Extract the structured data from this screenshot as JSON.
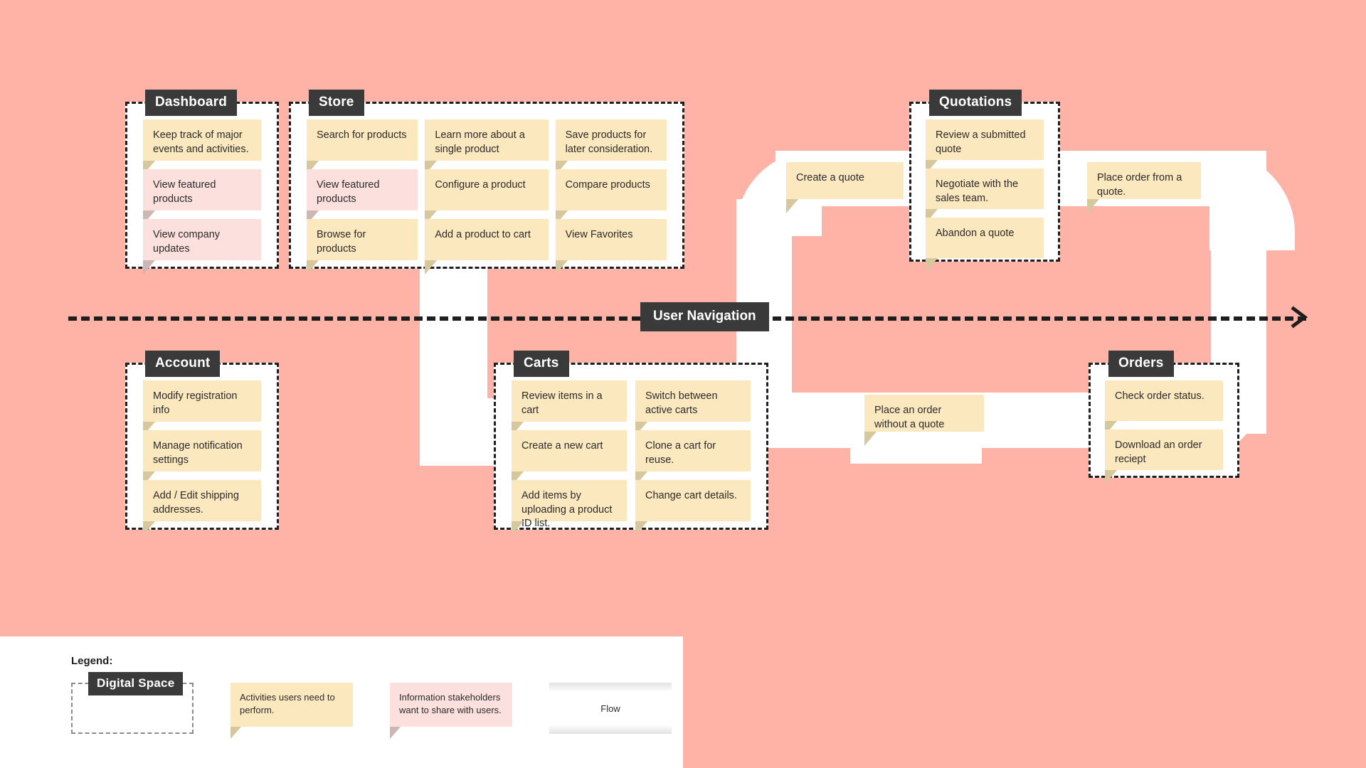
{
  "canvas": {
    "background": "#FFB3A7",
    "flow_color": "#FFFFFF"
  },
  "axis": {
    "label": "User Navigation",
    "arrow_icon": "arrow-right-icon"
  },
  "spaces": [
    {
      "id": "dashboard",
      "title": "Dashboard",
      "columns": [
        {
          "notes": [
            {
              "text": "Keep track of major events and activities.",
              "kind": "activity"
            },
            {
              "text": "View featured products",
              "kind": "info"
            },
            {
              "text": "View company updates",
              "kind": "info"
            }
          ]
        }
      ]
    },
    {
      "id": "store",
      "title": "Store",
      "columns": [
        {
          "notes": [
            {
              "text": "Search for products",
              "kind": "activity"
            },
            {
              "text": "View featured products",
              "kind": "info"
            },
            {
              "text": "Browse for products",
              "kind": "activity"
            }
          ]
        },
        {
          "notes": [
            {
              "text": "Learn more about a single product",
              "kind": "activity"
            },
            {
              "text": "Configure a product",
              "kind": "activity"
            },
            {
              "text": "Add a product to cart",
              "kind": "activity"
            }
          ]
        },
        {
          "notes": [
            {
              "text": "Save products for later consideration.",
              "kind": "activity"
            },
            {
              "text": "Compare products",
              "kind": "activity"
            },
            {
              "text": "View Favorites",
              "kind": "activity"
            }
          ]
        }
      ]
    },
    {
      "id": "quotations",
      "title": "Quotations",
      "columns": [
        {
          "notes": [
            {
              "text": "Review a submitted quote",
              "kind": "activity"
            },
            {
              "text": "Negotiate with the sales team.",
              "kind": "activity"
            },
            {
              "text": "Abandon a quote",
              "kind": "activity"
            }
          ]
        }
      ]
    },
    {
      "id": "account",
      "title": "Account",
      "columns": [
        {
          "notes": [
            {
              "text": "Modify registration info",
              "kind": "activity"
            },
            {
              "text": "Manage notification settings",
              "kind": "activity"
            },
            {
              "text": "Add / Edit shipping addresses.",
              "kind": "activity"
            }
          ]
        }
      ]
    },
    {
      "id": "carts",
      "title": "Carts",
      "columns": [
        {
          "notes": [
            {
              "text": "Review items in a cart",
              "kind": "activity"
            },
            {
              "text": "Create a new cart",
              "kind": "activity"
            },
            {
              "text": "Add items by uploading a product ID list.",
              "kind": "activity"
            }
          ]
        },
        {
          "notes": [
            {
              "text": "Switch between active carts",
              "kind": "activity"
            },
            {
              "text": "Clone a cart for reuse.",
              "kind": "activity"
            },
            {
              "text": "Change cart details.",
              "kind": "activity"
            }
          ]
        }
      ]
    },
    {
      "id": "orders",
      "title": "Orders",
      "columns": [
        {
          "notes": [
            {
              "text": "Check order status.",
              "kind": "activity"
            },
            {
              "text": "Download an order reciept",
              "kind": "activity"
            }
          ]
        }
      ]
    }
  ],
  "flow_notes": [
    {
      "id": "create-a-quote",
      "text": "Create a quote"
    },
    {
      "id": "place-order-from-a-quote",
      "text": "Place order from a quote."
    },
    {
      "id": "place-an-order-without-a-quote",
      "text": "Place an order without a quote"
    }
  ],
  "legend": {
    "title": "Legend:",
    "space_label": "Digital Space",
    "activity_note": "Activities users need to perform.",
    "info_note": "Information stakeholders want to share with users.",
    "flow_label": "Flow"
  }
}
